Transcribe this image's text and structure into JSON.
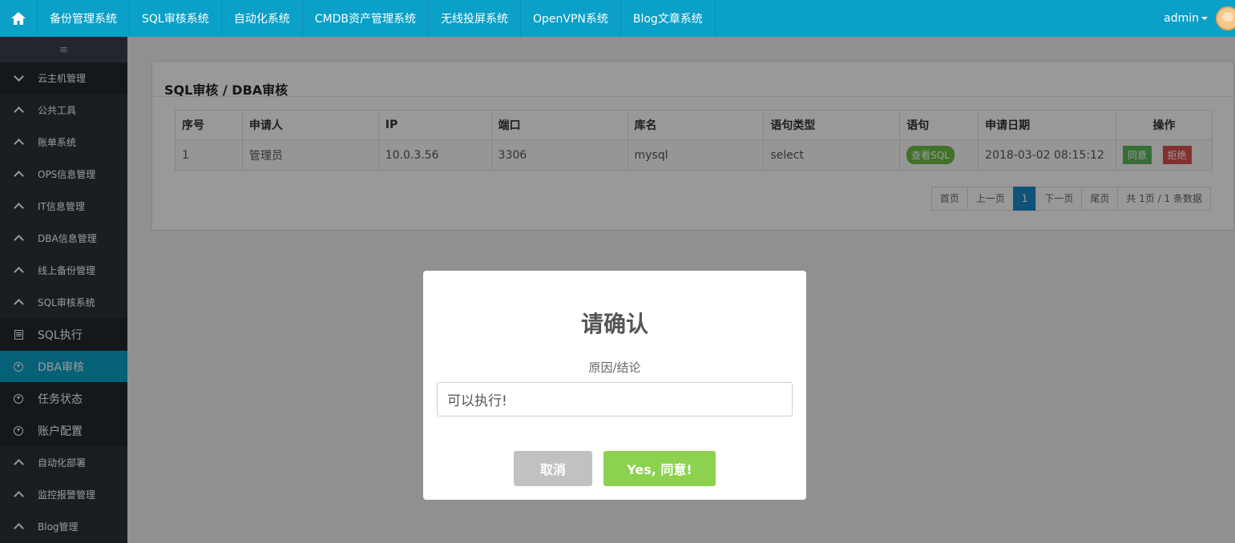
{
  "topnav": {
    "items": [
      "备份管理系统",
      "SQL审核系统",
      "自动化系统",
      "CMDB资产管理系统",
      "无线投屏系统",
      "OpenVPN系统",
      "Blog文章系统"
    ],
    "user": "admin"
  },
  "sidebar": {
    "toggle": "≡",
    "items": [
      {
        "label": "云主机管理",
        "icon": "chevron-down-icon"
      },
      {
        "label": "公共工具",
        "icon": "chevron-up-icon"
      },
      {
        "label": "账单系统",
        "icon": "chevron-up-icon"
      },
      {
        "label": "OPS信息管理",
        "icon": "chevron-up-icon"
      },
      {
        "label": "IT信息管理",
        "icon": "chevron-up-icon"
      },
      {
        "label": "DBA信息管理",
        "icon": "chevron-up-icon"
      },
      {
        "label": "线上备份管理",
        "icon": "chevron-up-icon"
      },
      {
        "label": "SQL审核系统",
        "icon": "chevron-up-icon"
      },
      {
        "label": "SQL执行",
        "icon": "list-icon"
      },
      {
        "label": "DBA审核",
        "icon": "circle-download-icon"
      },
      {
        "label": "任务状态",
        "icon": "circle-download-icon"
      },
      {
        "label": "账户配置",
        "icon": "circle-download-icon"
      },
      {
        "label": "自动化部署",
        "icon": "chevron-up-icon"
      },
      {
        "label": "监控报警管理",
        "icon": "chevron-up-icon"
      },
      {
        "label": "Blog管理",
        "icon": "chevron-up-icon"
      }
    ]
  },
  "panel": {
    "title": "SQL审核 / DBA审核",
    "columns": [
      "序号",
      "申请人",
      "IP",
      "端口",
      "库名",
      "语句类型",
      "语句",
      "申请日期",
      "操作"
    ],
    "rows": [
      {
        "id": "1",
        "applicant": "管理员",
        "ip": "10.0.3.56",
        "port": "3306",
        "db": "mysql",
        "type": "select",
        "view_sql": "查看SQL",
        "date": "2018-03-02 08:15:12",
        "agree": "同意",
        "reject": "拒绝"
      }
    ],
    "pager": {
      "first": "首页",
      "prev": "上一页",
      "current": "1",
      "next": "下一页",
      "last": "尾页",
      "summary": "共 1页 / 1 条数据"
    }
  },
  "modal": {
    "title": "请确认",
    "text": "原因/结论",
    "input_value": "可以执行!",
    "cancel": "取消",
    "confirm": "Yes, 同意!"
  },
  "colors": {
    "primary": "#0aa0c7",
    "sidebar": "#2c333b",
    "confirm": "#8cd24e",
    "cancel": "#c1c1c1",
    "agree": "#5cb85c",
    "reject": "#d9534f"
  }
}
